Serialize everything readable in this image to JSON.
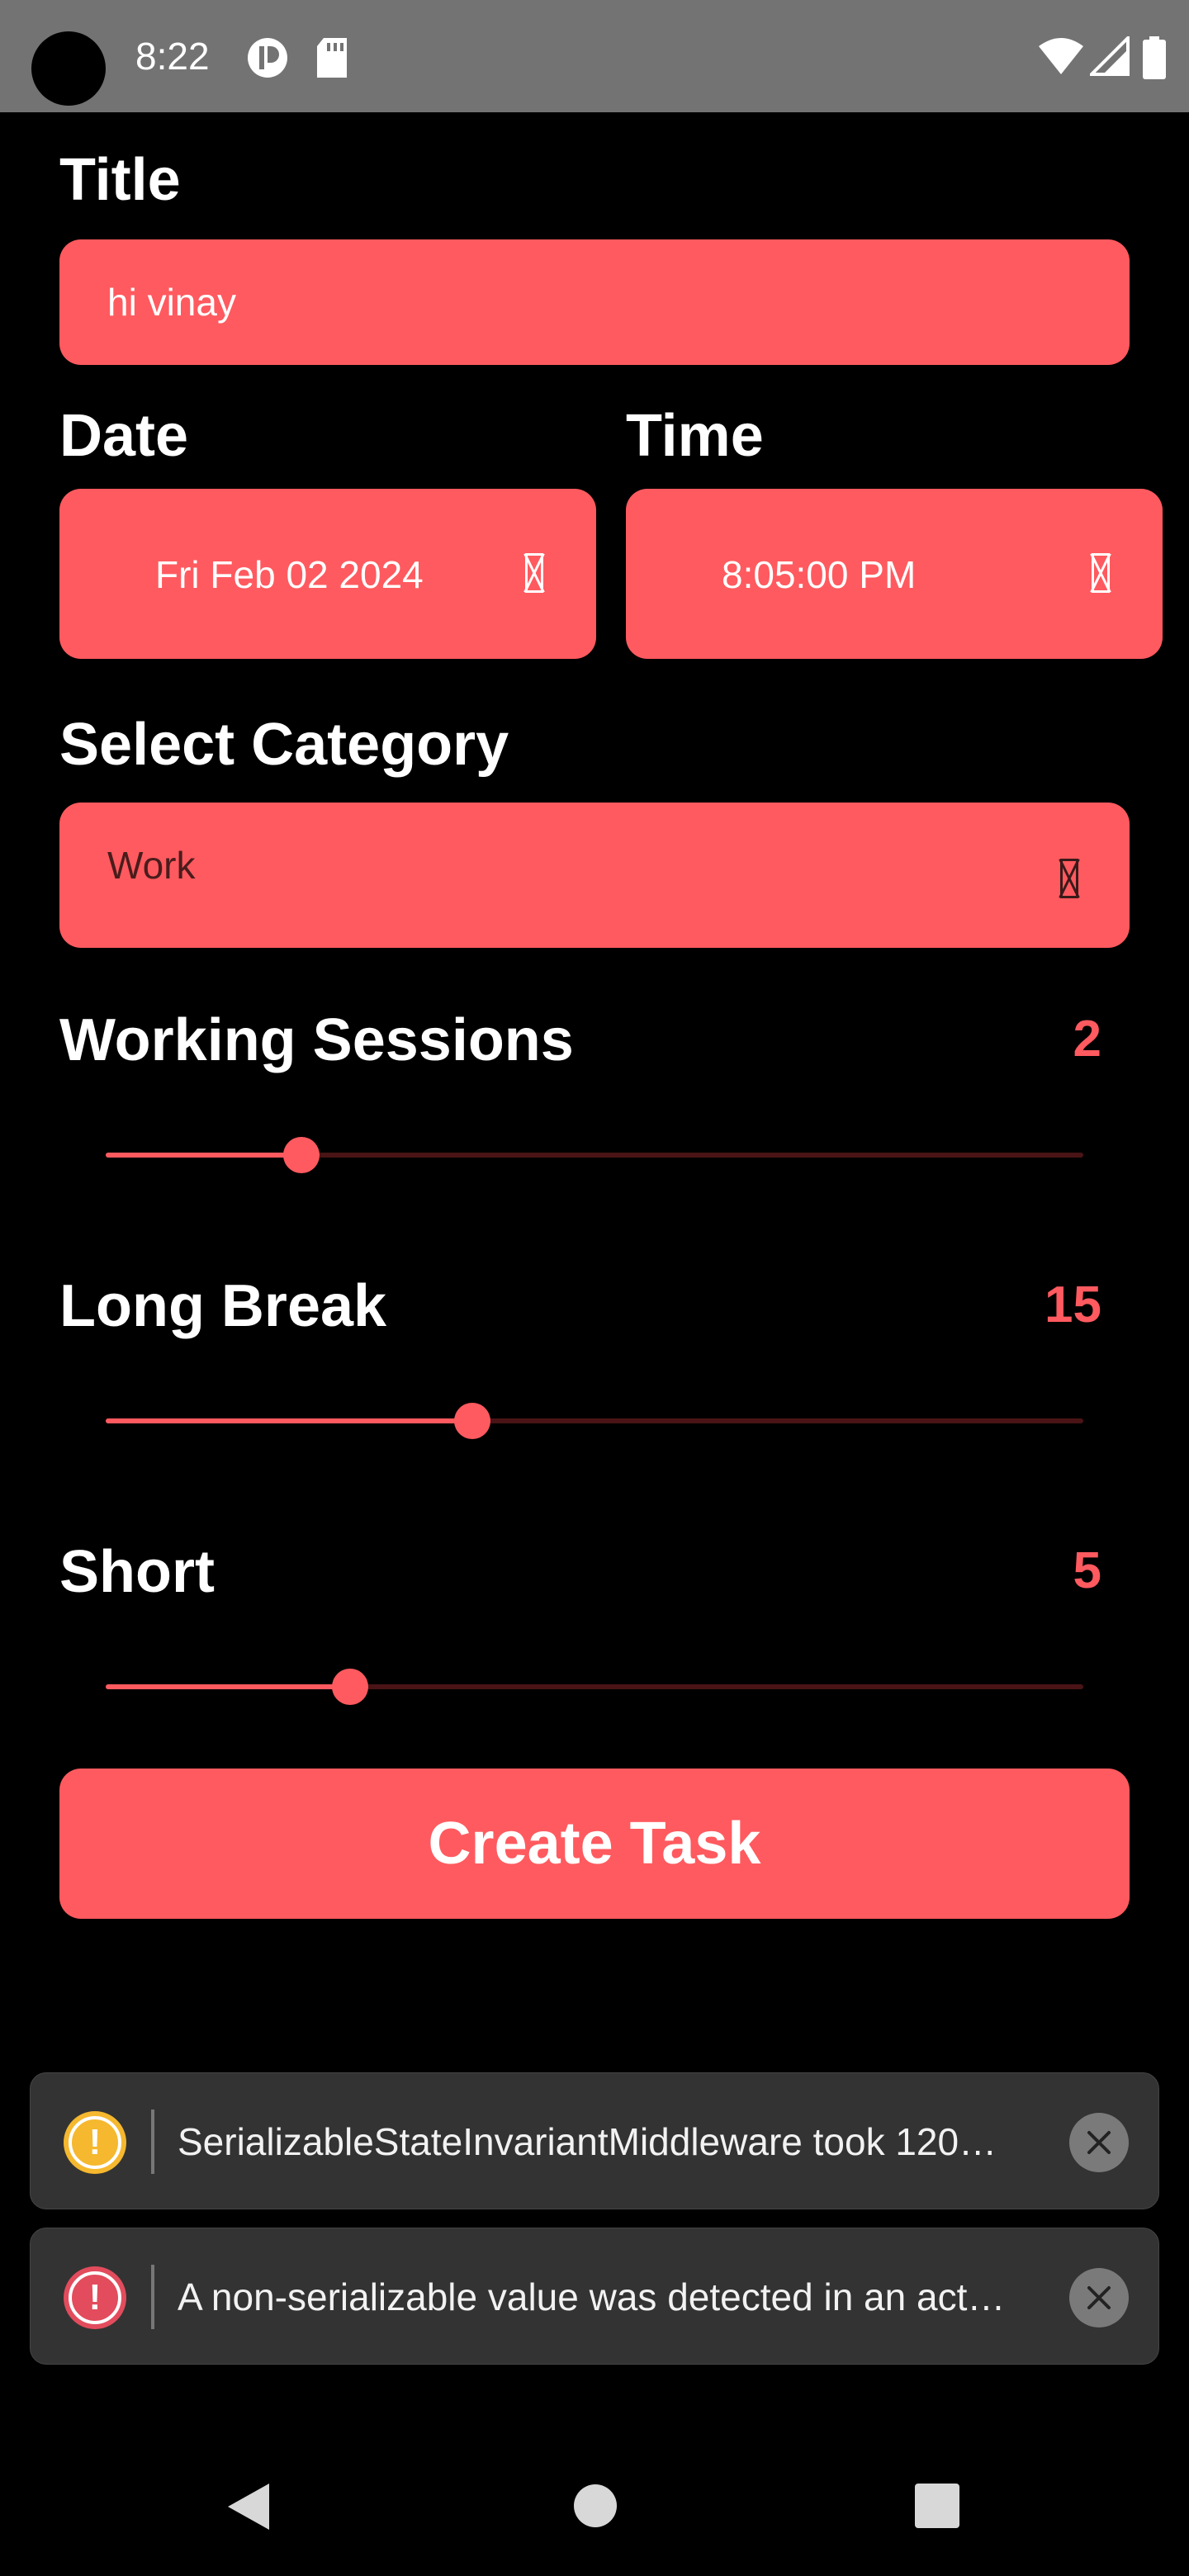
{
  "status_bar": {
    "time": "8:22",
    "icons": [
      "camera-icon",
      "app-notification-icon",
      "sd-card-icon",
      "wifi-icon",
      "signal-icon",
      "battery-icon"
    ]
  },
  "form": {
    "title_label": "Title",
    "title_value": "hi vinay",
    "date_label": "Date",
    "date_value": "Fri Feb 02 2024",
    "time_label": "Time",
    "time_value": "8:05:00 PM",
    "category_label": "Select Category",
    "category_value": "Work",
    "working_sessions": {
      "label": "Working Sessions",
      "value": "2",
      "fill": 0.2
    },
    "long_break": {
      "label": "Long Break",
      "value": "15",
      "fill": 0.375
    },
    "short_break": {
      "label": "Short",
      "value": "5",
      "fill": 0.25
    },
    "submit_label": "Create Task"
  },
  "toasts": [
    {
      "type": "warning",
      "icon_color": "#f5b82e",
      "icon": "!",
      "message": "SerializableStateInvariantMiddleware took 120…"
    },
    {
      "type": "error",
      "icon_color": "#e24c5c",
      "icon": "!",
      "message": "A non-serializable value was detected in an act…"
    }
  ],
  "colors": {
    "accent": "#ff5a5f",
    "background": "#000000",
    "status_bar": "#737373",
    "toast_bg": "#333333"
  },
  "nav_bar": {
    "icons": [
      "back-icon",
      "home-icon",
      "recents-icon"
    ]
  }
}
